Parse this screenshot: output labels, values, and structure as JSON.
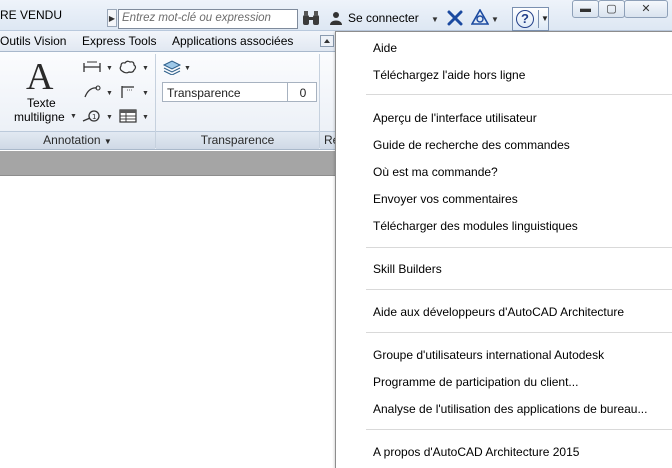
{
  "window": {
    "title": "RE VENDU",
    "min_glyph": "▬",
    "max_glyph": "▢",
    "close_glyph": "✕"
  },
  "search": {
    "placeholder": "Entrez mot-clé ou expression"
  },
  "account": {
    "signin_label": "Se connecter"
  },
  "help_button": {
    "glyph": "?"
  },
  "ribbon_tabs": [
    "Outils Vision",
    "Express Tools",
    "Applications associées"
  ],
  "ribbon": {
    "text_tool_label_line1": "Texte",
    "text_tool_label_line2": "multiligne",
    "annotation_panel_title": "Annotation",
    "transparency_field_label": "Transparence",
    "transparency_value": "0",
    "transparency_panel_title": "Transparence",
    "next_panel_title_partial": "Re"
  },
  "help_menu": {
    "items": [
      "Aide",
      "Téléchargez l'aide hors ligne",
      "Aperçu de l'interface utilisateur",
      "Guide de recherche des commandes",
      "Où est ma commande?",
      "Envoyer vos commentaires",
      "Télécharger des modules linguistiques",
      "Skill Builders",
      "Aide aux développeurs d'AutoCAD Architecture",
      "Groupe d'utilisateurs international Autodesk",
      "Programme de participation du client...",
      "Analyse de l'utilisation des applications de bureau...",
      "A propos d'AutoCAD Architecture 2015"
    ]
  },
  "colors": {
    "accent": "#23408a",
    "ribbon_bg": "#e9eef5",
    "gray_strip": "#a5a5a5"
  }
}
